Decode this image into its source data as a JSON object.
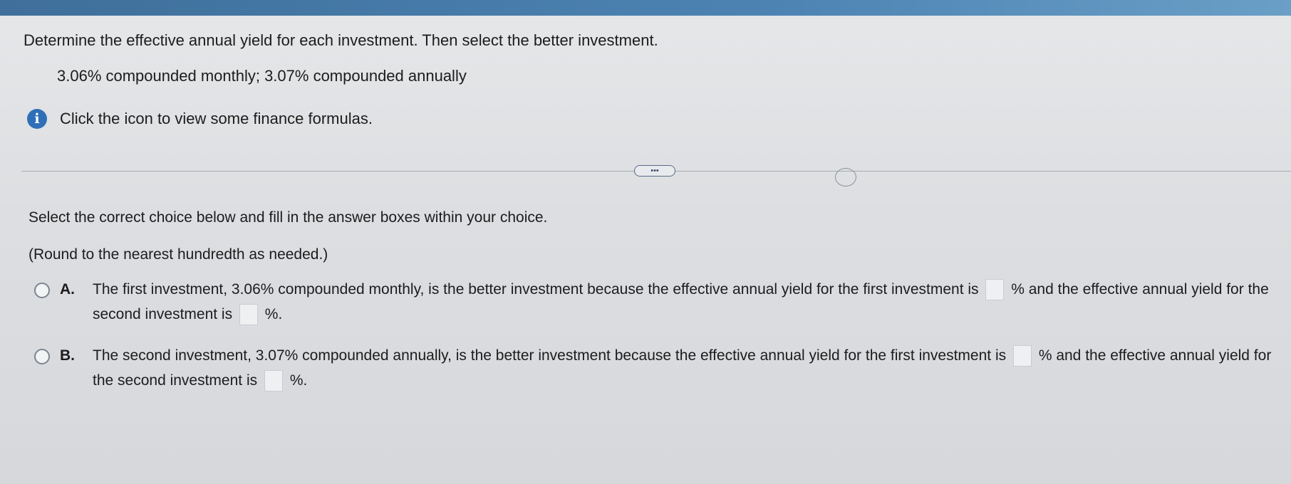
{
  "question": {
    "title": "Determine the effective annual yield for each investment. Then select the better investment.",
    "detail": "3.06% compounded monthly; 3.07% compounded annually"
  },
  "hint": {
    "icon": "i",
    "text": "Click the icon to view some finance formulas."
  },
  "more_button": {
    "label": "•••"
  },
  "instructions": {
    "text": "Select the correct choice below and fill in the answer boxes within your choice.",
    "round_note": "(Round to the nearest hundredth as needed.)"
  },
  "choices": [
    {
      "letter": "A.",
      "part1": "The first investment, 3.06% compounded monthly, is the better investment because the effective annual yield for the first investment is",
      "box1_value": "",
      "part2": "% and the effective annual yield for the second investment is",
      "box2_value": "",
      "part3": "%."
    },
    {
      "letter": "B.",
      "part1": "The second investment, 3.07% compounded annually, is the better investment because the effective annual yield for the first investment is",
      "box1_value": "",
      "part2": "% and the effective annual yield for the second investment is",
      "box2_value": "",
      "part3": "%."
    }
  ],
  "colors": {
    "header_bar": "#4c83b3",
    "info_icon": "#2f6fb7"
  }
}
